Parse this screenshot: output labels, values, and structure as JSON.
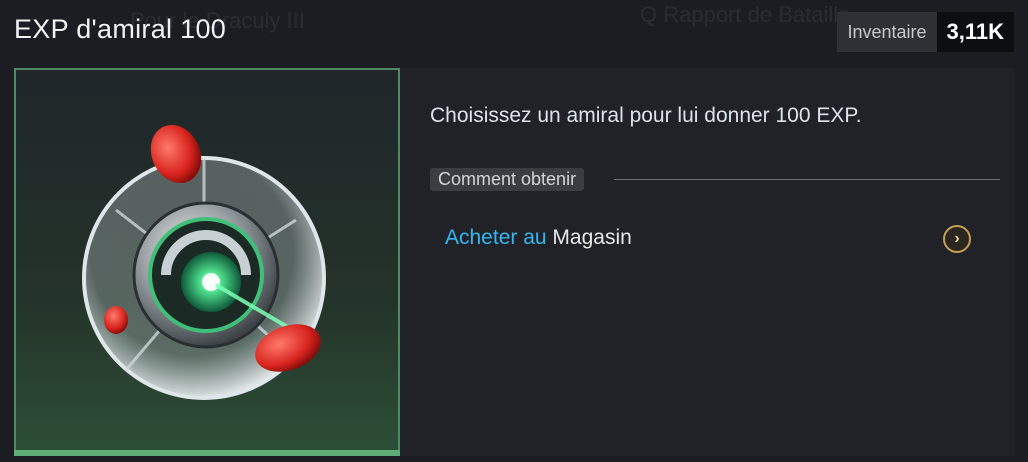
{
  "header": {
    "title": "EXP d'amiral 100",
    "inventory_label": "Inventaire",
    "inventory_value": "3,11K"
  },
  "item": {
    "icon": "admiral-exp-orb",
    "description": "Choisissez un amiral pour lui donner 100 EXP."
  },
  "obtain": {
    "heading": "Comment obtenir",
    "source_prefix": "Acheter au",
    "source_name": "Magasin",
    "go_icon": "chevron-right-icon"
  },
  "colors": {
    "accent_green": "#5fae78",
    "link_blue": "#35b6f1",
    "go_button_gold": "#c79e55"
  }
}
